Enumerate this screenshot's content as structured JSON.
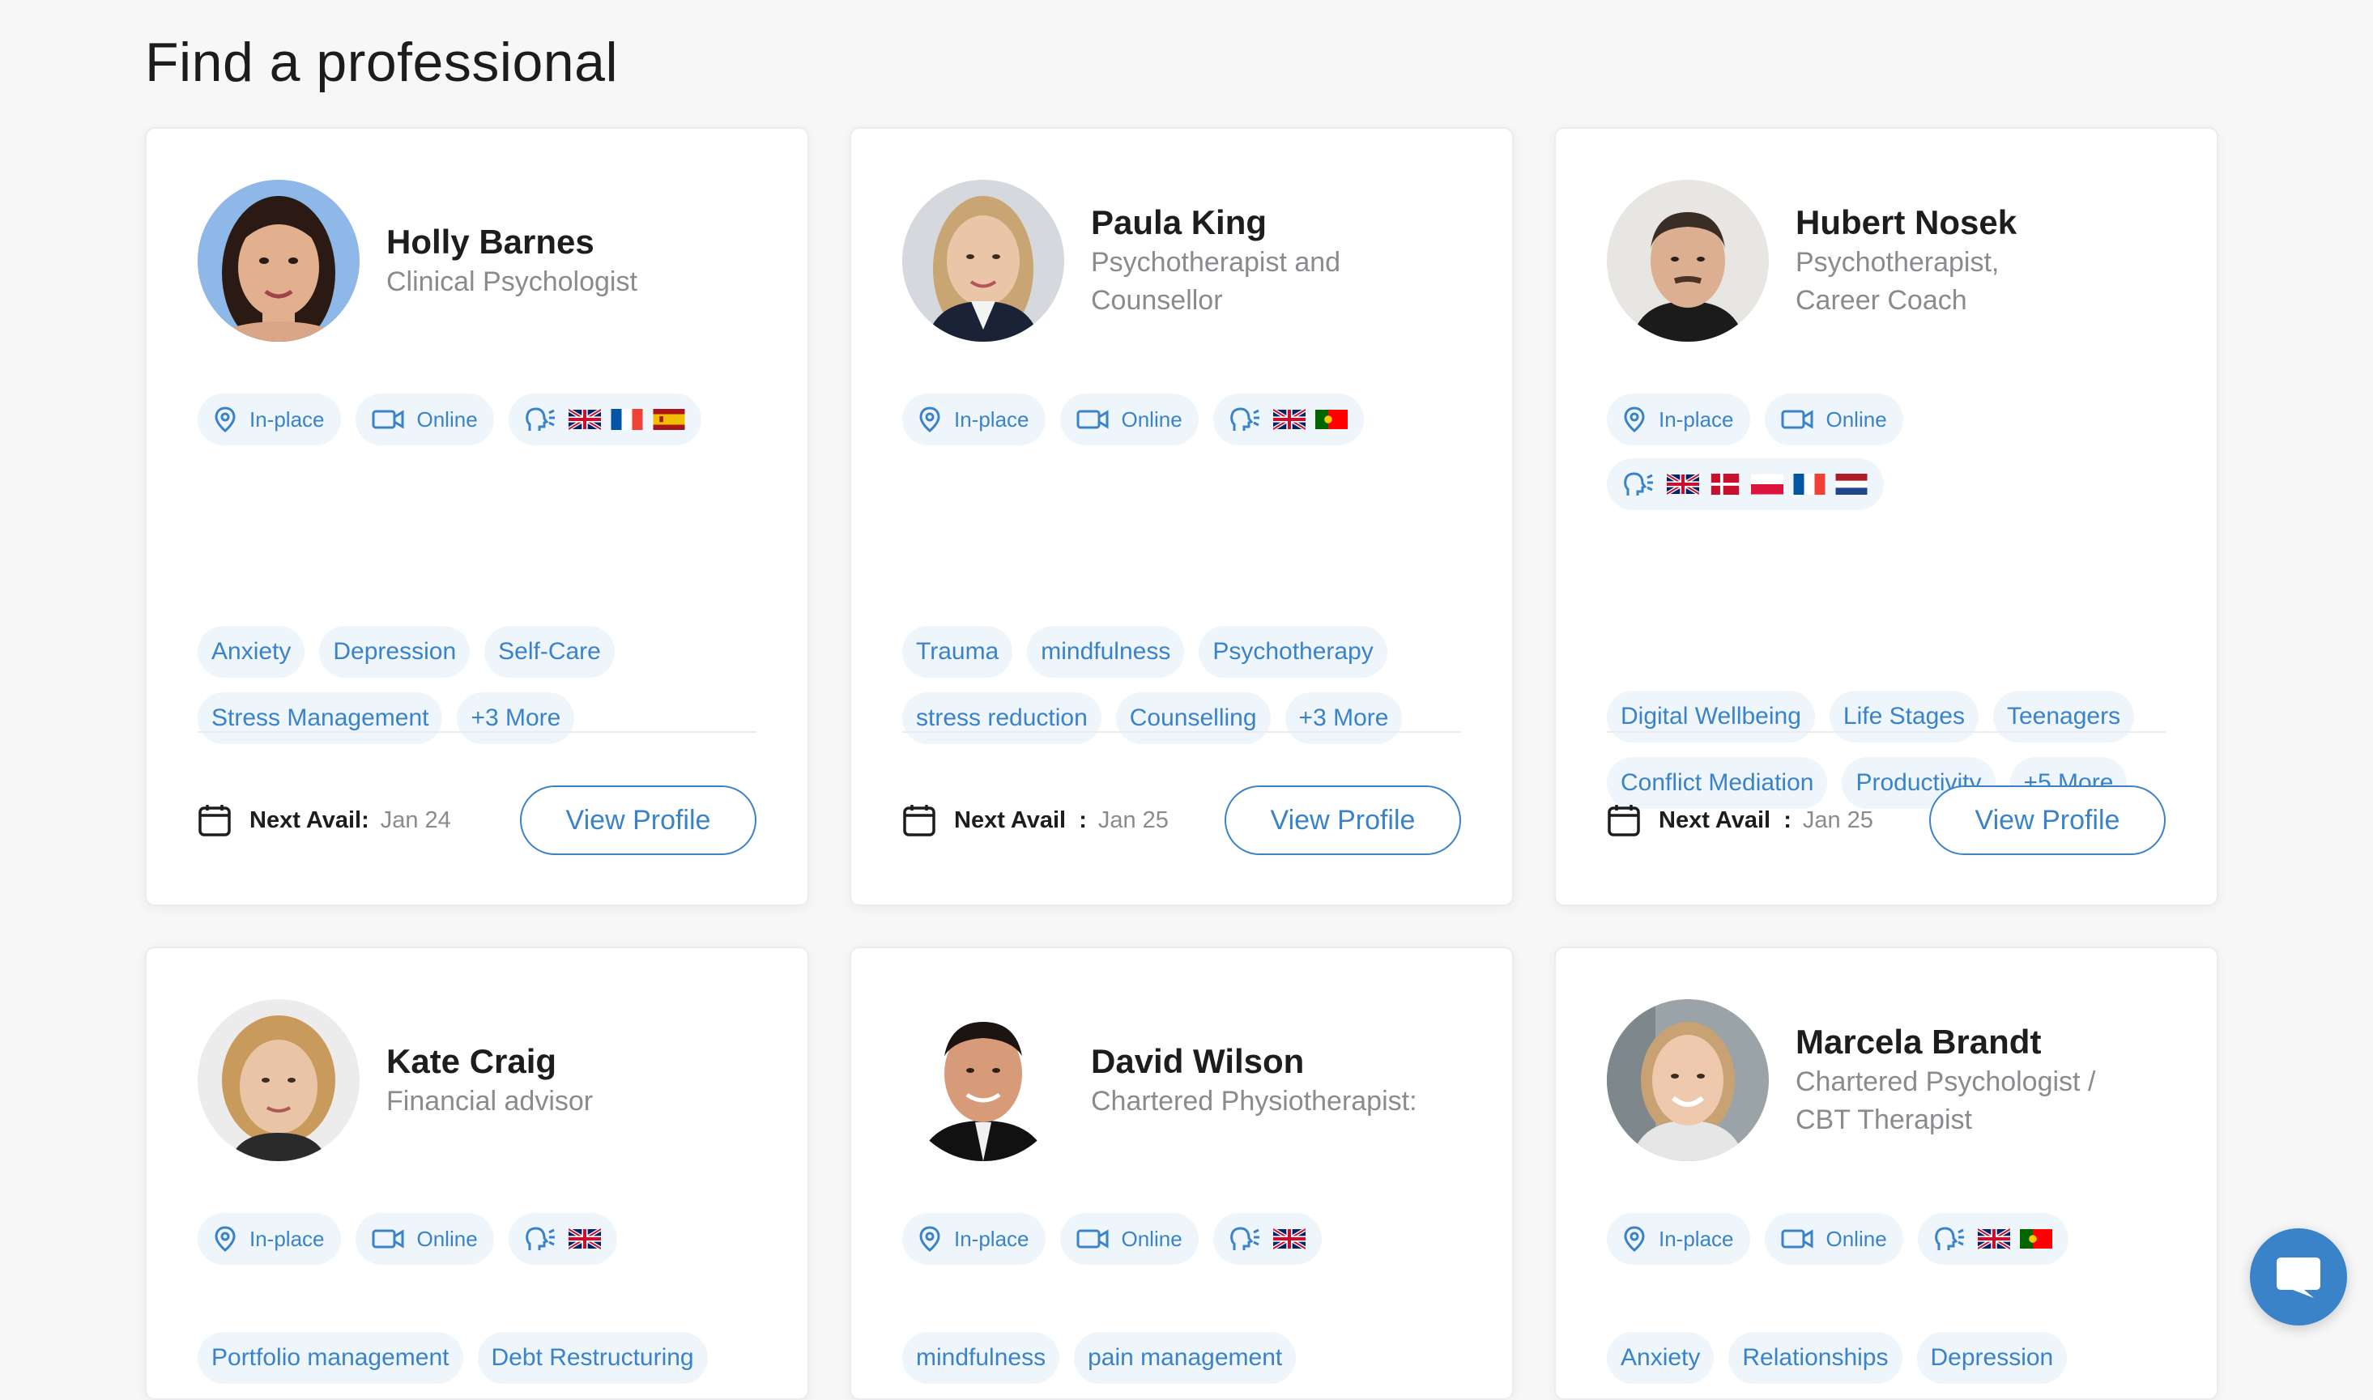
{
  "page": {
    "title": "Find a professional"
  },
  "labels": {
    "inplace": "In-place",
    "online": "Online",
    "next_avail": "Next Avail:",
    "next_avail_spaced": "Next Avail  :",
    "view_profile": "View Profile"
  },
  "colors": {
    "accent": "#3a83c9",
    "chip_bg": "#eef5fb",
    "muted": "#8a8a8f"
  },
  "professionals": [
    {
      "name": "Holly Barnes",
      "title": "Clinical Psychologist",
      "languages": [
        "uk-flag",
        "france-flag",
        "spain-flag"
      ],
      "tags": [
        "Anxiety",
        "Depression",
        "Self-Care",
        "Stress Management",
        "+3 More"
      ],
      "next_avail": "Jan 24"
    },
    {
      "name": "Paula King",
      "title": "Psychotherapist and Counsellor",
      "languages": [
        "uk-flag",
        "portugal-flag"
      ],
      "tags": [
        "Trauma",
        "mindfulness",
        "Psychotherapy",
        "stress reduction",
        "Counselling",
        "+3 More"
      ],
      "next_avail": "Jan 25"
    },
    {
      "name": "Hubert Nosek",
      "title": "Psychotherapist, Career Coach",
      "languages": [
        "uk-flag",
        "denmark-flag",
        "poland-flag",
        "france-flag",
        "netherlands-flag"
      ],
      "tags": [
        "Digital Wellbeing",
        "Life Stages",
        "Teenagers",
        "Conflict Mediation",
        "Productivity",
        "+5 More"
      ],
      "next_avail": "Jan 25"
    },
    {
      "name": "Kate Craig",
      "title": "Financial advisor",
      "languages": [
        "uk-flag"
      ],
      "tags": [
        "Portfolio management",
        "Debt Restructuring"
      ]
    },
    {
      "name": "David Wilson",
      "title": "Chartered Physiotherapist:",
      "languages": [
        "uk-flag"
      ],
      "tags": [
        "mindfulness",
        "pain management"
      ]
    },
    {
      "name": "Marcela Brandt",
      "title": "Chartered Psychologist / CBT Therapist",
      "languages": [
        "uk-flag",
        "portugal-flag"
      ],
      "tags": [
        "Anxiety",
        "Relationships",
        "Depression"
      ]
    }
  ],
  "icons": {
    "location": "location-pin-icon",
    "video": "video-camera-icon",
    "language": "speaking-head-icon",
    "calendar": "calendar-icon",
    "chat": "chat-bubble-icon"
  }
}
